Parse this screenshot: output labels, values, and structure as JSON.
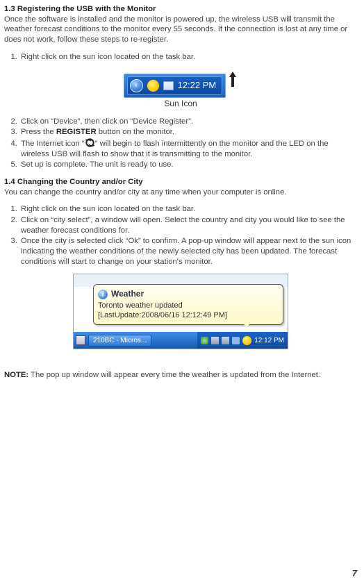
{
  "section1": {
    "heading": "1.3 Registering the USB with the Monitor",
    "para1": "Once the software is installed and the monitor is powered up, the wireless USB will transmit the weather forecast conditions to the monitor every 55 seconds. If the connection is lost at any time or does not work, follow these steps to re-register."
  },
  "list1": {
    "item1": "Right click on the sun icon located on the task bar."
  },
  "fig1": {
    "clock": "12:22 PM",
    "caption": "Sun Icon"
  },
  "list2": {
    "item2": "Click on “Device”, then click on “Device Register”.",
    "item3a": "Press the ",
    "item3b": "REGISTER",
    "item3c": " button on the monitor.",
    "item4a": "The Internet icon “",
    "item4b": "” will begin to flash intermittently on the monitor and the LED on the wireless USB will flash to show that it is transmitting to the monitor.",
    "item5": "Set up is complete. The unit is ready to use."
  },
  "section2": {
    "heading": "1.4 Changing the Country and/or City",
    "para": "You can change the country and/or city at any time when your computer is online."
  },
  "list3": {
    "item1": "Right click on the sun icon located on the task bar.",
    "item2": "Click on “city select”, a window will open. Select the country and city you would like to see the weather forecast conditions for.",
    "item3": "Once the city is selected click “Ok” to confirm. A pop-up window will appear next to the sun icon indicating the weather conditions of the newly selected city has been updated. The forecast conditions will start to change on your station's monitor."
  },
  "fig2": {
    "balloon_title": "Weather",
    "balloon_line1": "Toronto weather updated",
    "balloon_line2": "[LastUpdate:2008/06/16 12:12:49 PM]",
    "taskbar_task": "210BC - Micros...",
    "taskbar_clock": "12:12 PM"
  },
  "note": {
    "label": "NOTE:",
    "text": " The pop up window will appear every time the weather is updated from the Internet."
  },
  "page": "7"
}
